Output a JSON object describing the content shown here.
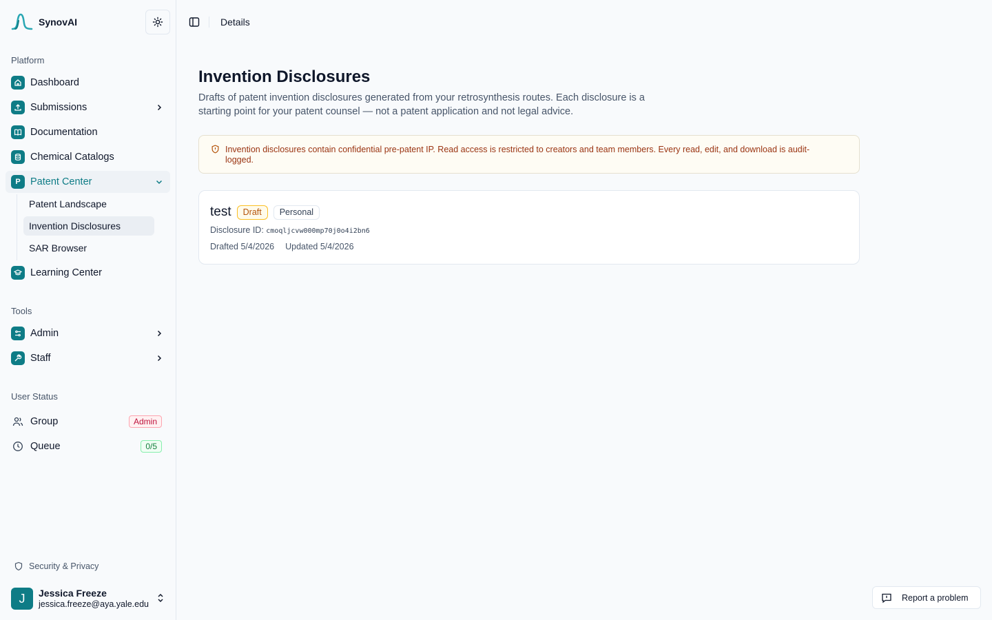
{
  "app": {
    "name": "SynovAI"
  },
  "sidebar": {
    "sections": {
      "platform": "Platform",
      "tools": "Tools",
      "user_status": "User Status"
    },
    "platform_items": [
      {
        "label": "Dashboard",
        "icon": "home-icon"
      },
      {
        "label": "Submissions",
        "icon": "upload-icon"
      },
      {
        "label": "Documentation",
        "icon": "book-icon"
      },
      {
        "label": "Chemical Catalogs",
        "icon": "database-icon"
      },
      {
        "label": "Patent Center",
        "icon_letter": "P"
      },
      {
        "label": "Learning Center",
        "icon": "graduation-cap-icon"
      }
    ],
    "patent_sub_items": [
      "Patent Landscape",
      "Invention Disclosures",
      "SAR Browser"
    ],
    "tool_items": [
      {
        "label": "Admin",
        "icon": "sliders-icon"
      },
      {
        "label": "Staff",
        "icon": "wrench-icon"
      }
    ],
    "status": {
      "group_label": "Group",
      "group_badge": "Admin",
      "queue_label": "Queue",
      "queue_badge": "0/5"
    },
    "security_label": "Security & Privacy",
    "user": {
      "initial": "J",
      "name": "Jessica Freeze",
      "email": "jessica.freeze@aya.yale.edu"
    }
  },
  "topbar": {
    "breadcrumb": "Details"
  },
  "main": {
    "title": "Invention Disclosures",
    "description": "Drafts of patent invention disclosures generated from your retrosynthesis routes. Each disclosure is a starting point for your patent counsel — not a patent application and not legal advice.",
    "alert": "Invention disclosures contain confidential pre-patent IP. Read access is restricted to creators and team members. Every read, edit, and download is audit-logged.",
    "disclosure": {
      "title": "test",
      "status": "Draft",
      "scope": "Personal",
      "id_label": "Disclosure ID:",
      "id": "cmoqljcvw000mp70j0o4i2bn6",
      "drafted": "Drafted 5/4/2026",
      "updated": "Updated 5/4/2026"
    }
  },
  "report_button": "Report a problem",
  "colors": {
    "accent": "#0e7c86",
    "warning_text": "#9a3412"
  }
}
